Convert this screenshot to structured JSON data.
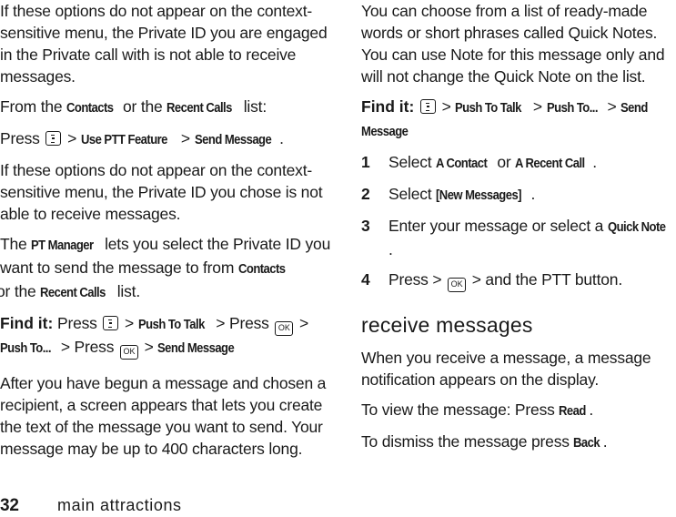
{
  "page": {
    "number": "32",
    "section_title": "main attractions"
  },
  "left_column": {
    "p1": "If these options do not appear on the context-sensitive menu, the Private ID you are engaged in the Private call with is not able to receive messages.",
    "p2": {
      "prefix": "From the ",
      "contacts": "Contacts",
      "middle": " or the ",
      "recent_calls": "Recent Calls",
      "suffix": " list:"
    },
    "p3": {
      "press": "Press",
      "sep": " > ",
      "use_ptt": "Use PTT Feature",
      "send_message": "Send Message",
      "end": "."
    },
    "p4": "If these options do not appear on the context-sensitive menu, the Private ID you chose is not able to receive messages.",
    "p5": {
      "prefix": "The ",
      "pt_manager": "PT Manager",
      "middle": " lets you select the Private ID you want to send the message to from ",
      "contacts": "Contacts",
      "or_the": " or the ",
      "recent_calls": "Recent Calls",
      "suffix": " list."
    },
    "find_it": {
      "label": "Find it:",
      "press1": " Press ",
      "push_to_talk": "Push To Talk",
      "press2": " > Press ",
      "push_to": "Push To...",
      "press3": " > Press ",
      "send_message": "Send Message",
      "sep": " > "
    },
    "p6": "After you have begun a message and chosen a recipient, a screen appears that lets you create the text of the message you want to send. Your message may be up to 400 characters long."
  },
  "right_column": {
    "p1": "You can choose from a list of ready-made words or short phrases called Quick Notes. You can use Note for this message only and will not change the Quick Note on the list.",
    "find_it": {
      "label": "Find it:",
      "sep": " > ",
      "push_to_talk": "Push To Talk",
      "push_to": "Push To...",
      "send_message": "Send Message"
    },
    "steps": [
      {
        "num": "1",
        "pre": "Select ",
        "bold1": "A Contact",
        "mid": " or ",
        "bold2": "A Recent Call",
        "post": "."
      },
      {
        "num": "2",
        "pre": "Select ",
        "bold1": "[New Messages]",
        "post": "."
      },
      {
        "num": "3",
        "pre": "Enter your message or select a ",
        "bold1": "Quick Note",
        "post": "."
      },
      {
        "num": "4",
        "pre": "Press > ",
        "post": " > and the PTT button."
      }
    ],
    "heading": "receive messages",
    "p2": "When you receive a message, a message notification appears on the display.",
    "p3": {
      "pre": "To view the message: Press ",
      "bold": "Read",
      "post": "."
    },
    "p4": {
      "pre": "To dismiss the message press ",
      "bold": "Back",
      "post": "."
    }
  },
  "icons": {
    "menu_key": "menu-key",
    "ok_key": "OK"
  }
}
